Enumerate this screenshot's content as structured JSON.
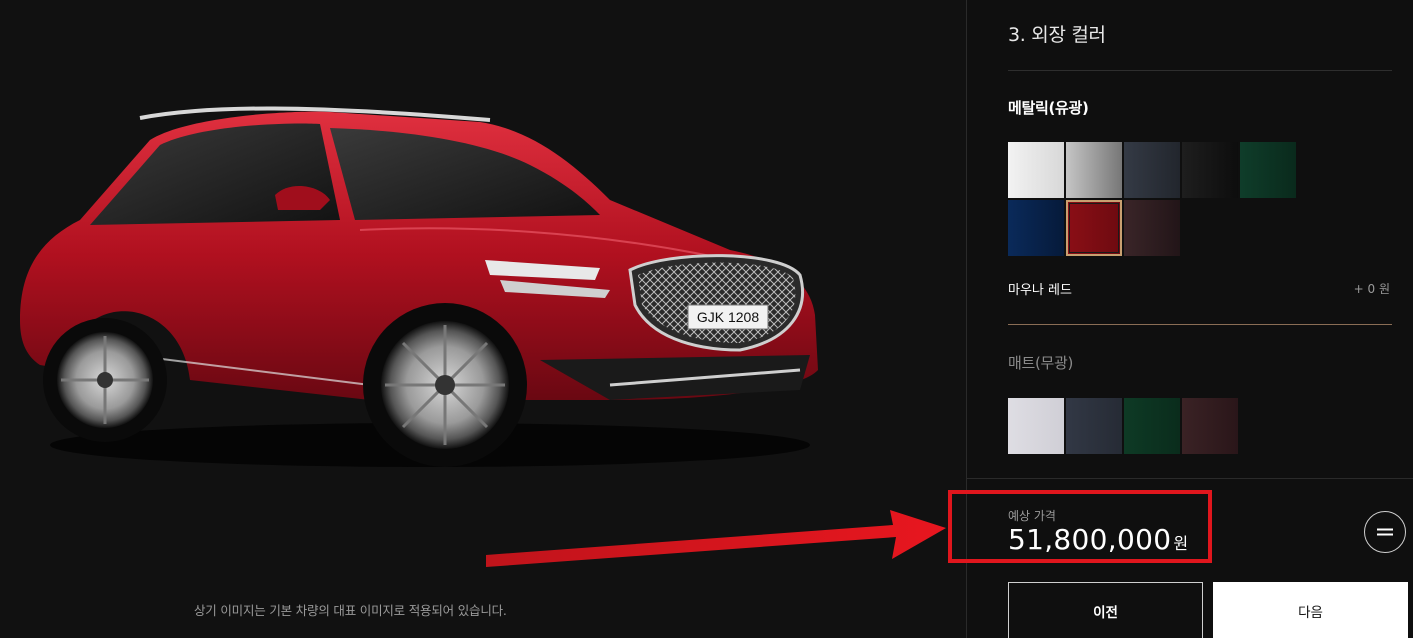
{
  "stage": {
    "plate": "GJK 1208",
    "disclaimer": "상기 이미지는 기본 차량의 대표 이미지로 적용되어 있습니다."
  },
  "panel": {
    "step_title": "3. 외장 컬러",
    "metallic": {
      "title": "메탈릭(유광)",
      "swatches": [
        {
          "color": "#f2f2f2",
          "gradient": "#d8d8d8"
        },
        {
          "color": "#c5c5c5",
          "gradient": "#777777"
        },
        {
          "color": "#343a45",
          "gradient": "#22262d"
        },
        {
          "color": "#1e1e1e",
          "gradient": "#0d0d0d"
        },
        {
          "color": "#0f3d2a",
          "gradient": "#0a2a1c"
        },
        {
          "color": "#0a2a5a",
          "gradient": "#061a3a"
        },
        {
          "color": "#8b0f16",
          "gradient": "#6d0a10",
          "selected": true
        },
        {
          "color": "#3a2528",
          "gradient": "#221518"
        }
      ],
      "selected_name": "마우나 레드",
      "selected_price": "+ 0 원"
    },
    "matte": {
      "title": "매트(무광)",
      "swatches": [
        {
          "color": "#dedde3",
          "gradient": "#d0cfd6"
        },
        {
          "color": "#323845",
          "gradient": "#262b35"
        },
        {
          "color": "#0e3a25",
          "gradient": "#0a2c1c"
        },
        {
          "color": "#3a2225",
          "gradient": "#2a1619"
        }
      ]
    },
    "price": {
      "label": "예상 가격",
      "value": "51,800,000",
      "unit": "원"
    },
    "buttons": {
      "prev": "이전",
      "next": "다음"
    }
  },
  "colors": {
    "accent_divider": "#8a6d55",
    "highlight": "#e0161d",
    "selected_outline": "#c8a070"
  }
}
